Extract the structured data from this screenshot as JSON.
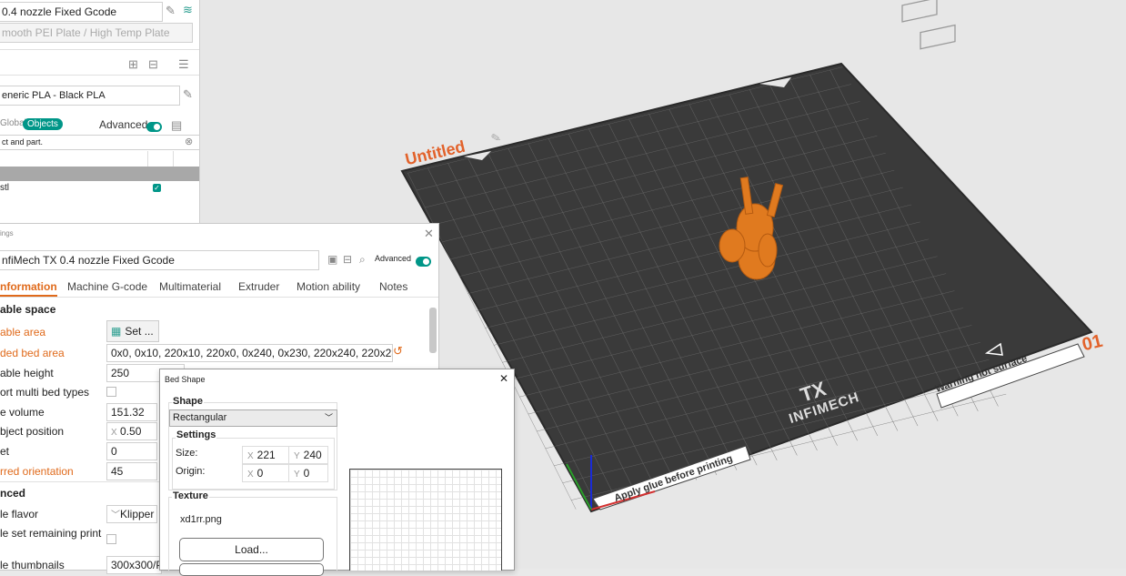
{
  "left_panel": {
    "printer_name": "0.4 nozzle Fixed Gcode",
    "plate_type": "mooth PEI Plate / High Temp Plate",
    "filament_name": "eneric PLA - Black PLA",
    "tab_global": "Global",
    "tab_objects": "Objects",
    "advanced_label": "Advanced",
    "search_placeholder": "ct and part.",
    "object_name": "stl"
  },
  "printer_settings": {
    "title": "ings",
    "preset_name": "nfiMech TX 0.4 nozzle Fixed Gcode",
    "advanced_label": "Advanced",
    "tabs": [
      "nformation",
      "Machine G-code",
      "Multimaterial",
      "Extruder",
      "Motion ability",
      "Notes"
    ],
    "section_printable_space": "able space",
    "rows": {
      "printable_area_label": "able area",
      "printable_area_button": "Set ...",
      "excluded_bed_label": "ded bed area",
      "excluded_bed_value": "0x0, 0x10, 220x10, 220x0, 0x240, 0x230, 220x240, 220x230",
      "printable_height_label": "able height",
      "printable_height_value": "250",
      "multi_bed_label": "ort multi bed types",
      "volume_label": "e volume",
      "volume_value": "151.32",
      "object_pos_label": "bject position",
      "object_pos_axis": "X",
      "object_pos_value": "0.50",
      "offset_label": "et",
      "offset_value": "0",
      "orientation_label": "rred orientation",
      "orientation_value": "45"
    },
    "section_advanced": "nced",
    "adv_rows": {
      "flavor_label": "le flavor",
      "flavor_value": "Klipper",
      "remaining_label": "le set remaining print",
      "thumbnails_label": "le thumbnails",
      "thumbnails_value": "300x300/P"
    }
  },
  "bed_shape": {
    "title": "Bed Shape",
    "shape_label": "Shape",
    "shape_value": "Rectangular",
    "settings_label": "Settings",
    "size_label": "Size:",
    "size_x": "221",
    "size_y": "240",
    "origin_label": "Origin:",
    "origin_x": "0",
    "origin_y": "0",
    "axis_x": "X",
    "axis_y": "Y",
    "texture_label": "Texture",
    "texture_file": "xd1rr.png",
    "load_button": "Load..."
  },
  "viewport": {
    "plate_title": "Untitled",
    "plate_number": "01",
    "brand_logo": "TX",
    "brand_name": "INFIMECH",
    "warning_text": "Warning hot surface",
    "glue_text": "Apply glue before printing",
    "bed_color": "#3c3c3c",
    "model_color": "#e07a1f",
    "accent_color": "#e2622b"
  }
}
